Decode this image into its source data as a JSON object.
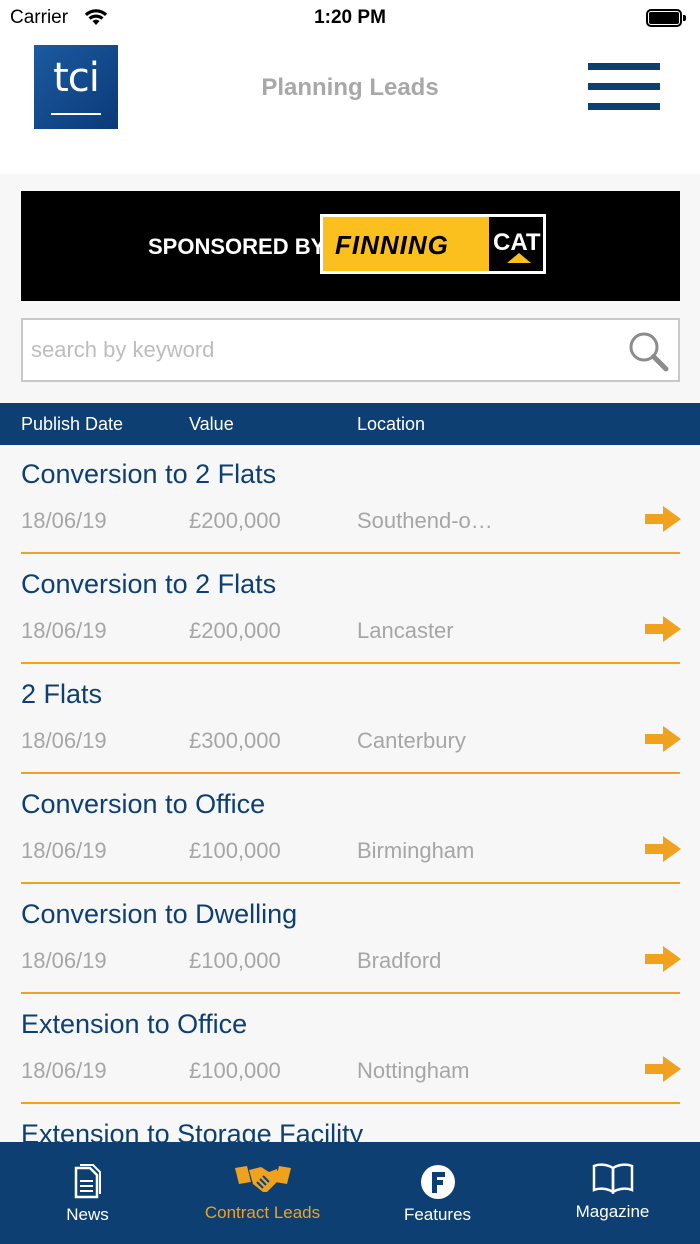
{
  "status_bar": {
    "carrier": "Carrier",
    "time": "1:20 PM"
  },
  "header": {
    "logo_text": "tci",
    "title": "Planning Leads"
  },
  "sponsor": {
    "prefix": "SPONSORED BY",
    "brand": "FINNING",
    "brand2": "CAT"
  },
  "search": {
    "placeholder": "search by keyword",
    "value": ""
  },
  "columns": {
    "date": "Publish Date",
    "value": "Value",
    "location": "Location"
  },
  "leads": [
    {
      "title": "Conversion to 2 Flats",
      "date": "18/06/19",
      "value": "£200,000",
      "location": "Southend-o…"
    },
    {
      "title": "Conversion to 2 Flats",
      "date": "18/06/19",
      "value": "£200,000",
      "location": "Lancaster"
    },
    {
      "title": "2 Flats",
      "date": "18/06/19",
      "value": "£300,000",
      "location": "Canterbury"
    },
    {
      "title": "Conversion to Office",
      "date": "18/06/19",
      "value": "£100,000",
      "location": "Birmingham"
    },
    {
      "title": "Conversion to Dwelling",
      "date": "18/06/19",
      "value": "£100,000",
      "location": "Bradford"
    },
    {
      "title": "Extension to Office",
      "date": "18/06/19",
      "value": "£100,000",
      "location": "Nottingham"
    },
    {
      "title": "Extension to Storage Facility",
      "date": "",
      "value": "",
      "location": ""
    }
  ],
  "tabs": [
    {
      "label": "News",
      "icon": "document-icon",
      "active": false
    },
    {
      "label": "Contract Leads",
      "icon": "handshake-icon",
      "active": true
    },
    {
      "label": "Features",
      "icon": "features-f-icon",
      "active": false
    },
    {
      "label": "Magazine",
      "icon": "book-icon",
      "active": false
    }
  ],
  "colors": {
    "brand_blue": "#0d3f72",
    "accent_orange": "#f0a21e",
    "muted_text": "#a6a6a6"
  }
}
